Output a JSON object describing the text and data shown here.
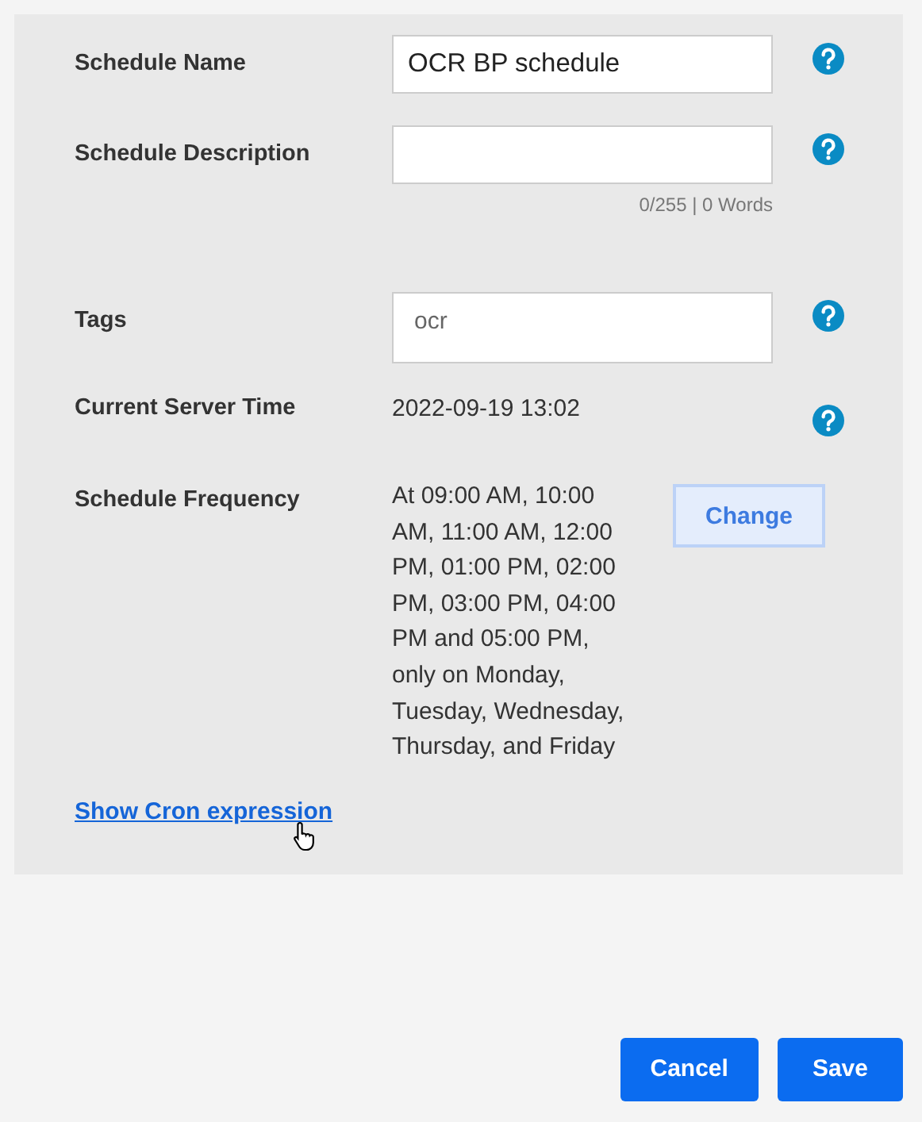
{
  "fields": [
    {
      "kind": "input",
      "label": "Schedule Name",
      "value": "OCR BP schedule",
      "help": true
    },
    {
      "kind": "textarea",
      "label": "Schedule Description",
      "counter": "0/255 | 0 Words",
      "help": true
    },
    {
      "kind": "tags",
      "label": "Tags",
      "value": "ocr",
      "help": true
    },
    {
      "kind": "text",
      "label": "Current Server Time",
      "value": "2022-09-19 13:02",
      "help": true
    },
    {
      "kind": "frequency",
      "label": "Schedule Frequency",
      "value": "At 09:00 AM, 10:00 AM, 11:00 AM, 12:00 PM, 01:00 PM, 02:00 PM, 03:00 PM, 04:00 PM and 05:00 PM, only on Monday, Tuesday, Wednesday, Thursday, and Friday",
      "button": "Change"
    }
  ],
  "link": "Show Cron expression",
  "buttons": [
    "Cancel",
    "Save"
  ]
}
